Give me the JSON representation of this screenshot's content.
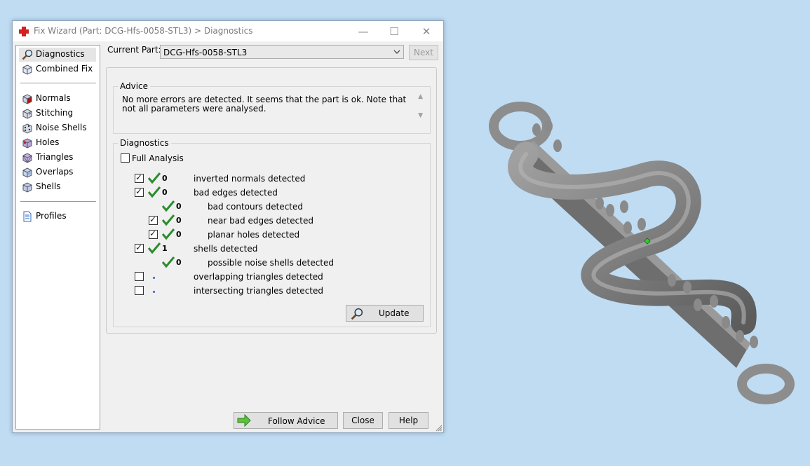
{
  "window": {
    "title": "Fix Wizard (Part: DCG-Hfs-0058-STL3) > Diagnostics",
    "minimize": "—",
    "maximize": "☐",
    "close": "✕"
  },
  "sidebar": {
    "items": [
      {
        "label": "Diagnostics",
        "icon": "magnifier-icon"
      },
      {
        "label": "Combined Fix",
        "icon": "cube-icon"
      },
      {
        "label": "Normals",
        "icon": "normals-cube-icon"
      },
      {
        "label": "Stitching",
        "icon": "stitching-cube-icon"
      },
      {
        "label": "Noise Shells",
        "icon": "noise-shells-cube-icon"
      },
      {
        "label": "Holes",
        "icon": "holes-cube-icon"
      },
      {
        "label": "Triangles",
        "icon": "triangles-cube-icon"
      },
      {
        "label": "Overlaps",
        "icon": "overlaps-cube-icon"
      },
      {
        "label": "Shells",
        "icon": "shells-cube-icon"
      },
      {
        "label": "Profiles",
        "icon": "document-icon"
      }
    ]
  },
  "current_part": {
    "label": "Current Part:",
    "value": "DCG-Hfs-0058-STL3",
    "next_label": "Next"
  },
  "advice": {
    "title": "Advice",
    "text": "No more errors are detected. It seems that the part is ok. Note that not all parameters were analysed."
  },
  "diagnostics": {
    "title": "Diagnostics",
    "full_analysis_label": "Full Analysis",
    "rows": [
      {
        "count": "0",
        "label": "inverted normals detected",
        "checked": true,
        "status": "ok"
      },
      {
        "count": "0",
        "label": "bad edges detected",
        "checked": true,
        "status": "ok"
      },
      {
        "count": "0",
        "label": "bad contours detected",
        "checked": null,
        "status": "ok"
      },
      {
        "count": "0",
        "label": "near bad edges detected",
        "checked": true,
        "status": "ok"
      },
      {
        "count": "0",
        "label": "planar holes detected",
        "checked": true,
        "status": "ok"
      },
      {
        "count": "1",
        "label": "shells detected",
        "checked": true,
        "status": "ok"
      },
      {
        "count": "0",
        "label": "possible noise shells detected",
        "checked": null,
        "status": "ok"
      },
      {
        "count": "",
        "label": "overlapping triangles detected",
        "checked": false,
        "status": "not-run"
      },
      {
        "count": "",
        "label": "intersecting triangles detected",
        "checked": false,
        "status": "not-run"
      }
    ],
    "update_label": "Update"
  },
  "footer": {
    "follow_advice_label": "Follow Advice",
    "close_label": "Close",
    "help_label": "Help"
  },
  "colors": {
    "check_green": "#2e8b2e",
    "model_gray": "#8a8a8a",
    "desktop_bg": "#bfdcf3"
  }
}
